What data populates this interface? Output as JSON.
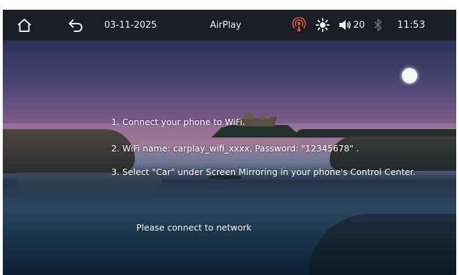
{
  "status_bar": {
    "home_icon": "home-icon",
    "back_icon": "back-arrow-icon",
    "date": "03-11-2025",
    "title": "AirPlay",
    "icons": [
      "wireless-signal-icon",
      "brightness-icon",
      "volume-icon",
      "bluetooth-icon"
    ],
    "volume_level": "20",
    "time": "11:53"
  },
  "instructions": {
    "step1": "1. Connect your phone to WiFi.",
    "step2": "2. WiFi name: carplay_wifi_xxxx, Password:   \"12345678\"  .",
    "step3": "3. Select   \"Car\"   under Screen Mirroring in your phone's Control Center."
  },
  "network_message": "Please connect to network"
}
